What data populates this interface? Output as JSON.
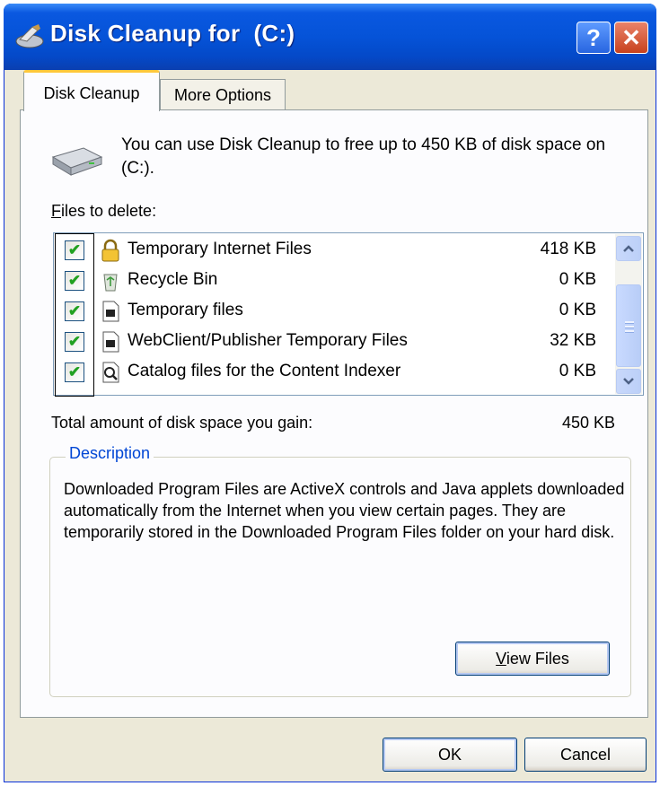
{
  "window": {
    "title": "Disk Cleanup for  (C:)",
    "help_symbol": "?",
    "close_symbol": "✕"
  },
  "tabs": [
    {
      "label": "Disk Cleanup",
      "active": true
    },
    {
      "label": "More Options",
      "active": false
    }
  ],
  "intro": "You can use Disk Cleanup to free up to 450 KB of disk space on  (C:).",
  "files_label": {
    "accel": "F",
    "rest": "iles to delete:"
  },
  "files": [
    {
      "name": "Temporary Internet Files",
      "size": "418 KB",
      "checked": true,
      "icon": "lock-icon"
    },
    {
      "name": "Recycle Bin",
      "size": "0 KB",
      "checked": true,
      "icon": "recycle-bin-icon"
    },
    {
      "name": "Temporary files",
      "size": "0 KB",
      "checked": true,
      "icon": "document-icon"
    },
    {
      "name": "WebClient/Publisher Temporary Files",
      "size": "32 KB",
      "checked": true,
      "icon": "document-icon"
    },
    {
      "name": "Catalog files for the Content Indexer",
      "size": "0 KB",
      "checked": true,
      "icon": "search-document-icon"
    }
  ],
  "check_mark": "✔",
  "total": {
    "label": "Total amount of disk space you gain:",
    "value": "450 KB"
  },
  "description": {
    "legend": "Description",
    "text": "Downloaded Program Files are ActiveX controls and Java applets downloaded automatically from the Internet when you view certain pages. They are temporarily stored in the Downloaded Program Files folder on your hard disk."
  },
  "buttons": {
    "view_files": {
      "accel": "V",
      "rest": "iew Files"
    },
    "ok": "OK",
    "cancel": "Cancel"
  },
  "colors": {
    "title_bar": "#0553d8",
    "legend_text": "#0046d5",
    "check_green": "#21a121"
  }
}
